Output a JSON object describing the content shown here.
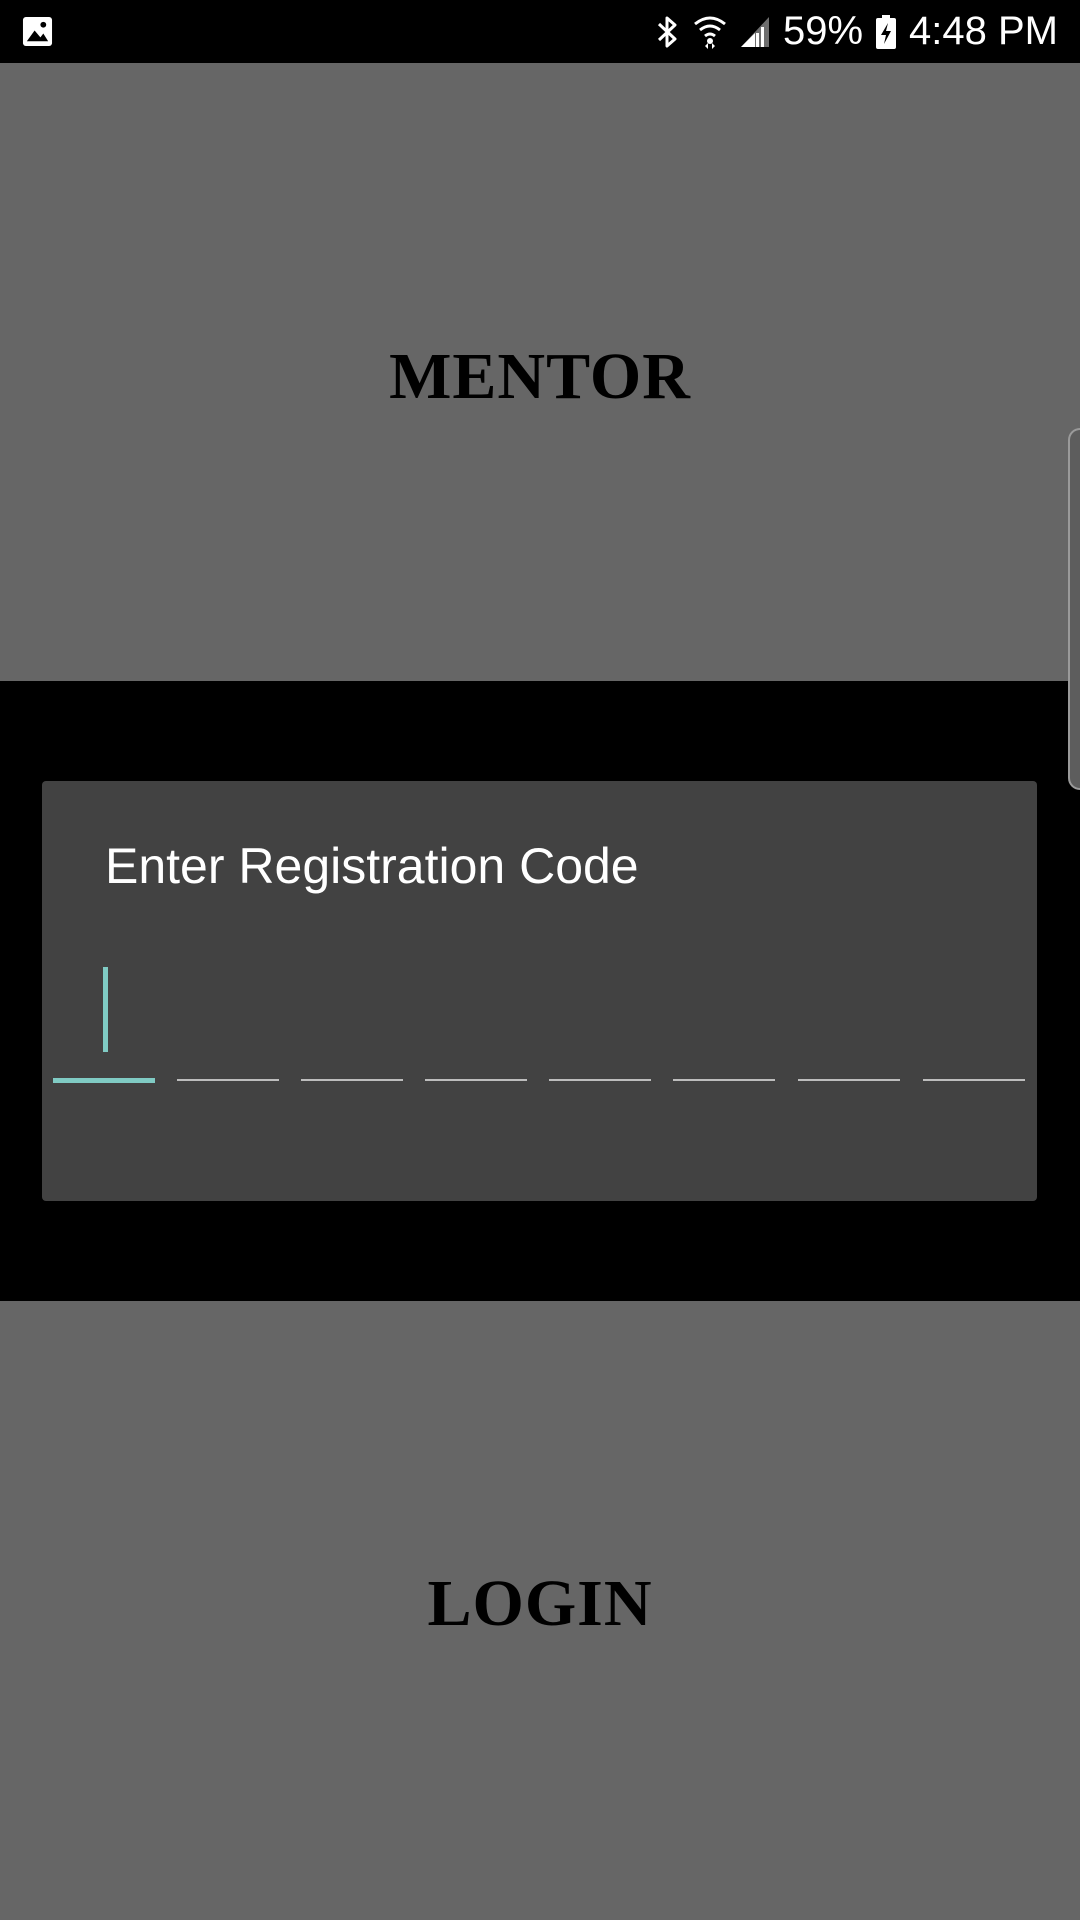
{
  "status_bar": {
    "left_icon": "gallery-image-icon",
    "icons": [
      "bluetooth-icon",
      "wifi-icon",
      "signal-icon"
    ],
    "battery_percent": "59%",
    "battery_icon": "battery-charging-icon",
    "time": "4:48 PM"
  },
  "top_option": {
    "label": "MENTOR"
  },
  "bottom_option": {
    "label": "LOGIN"
  },
  "dialog": {
    "title": "Enter Registration Code",
    "code_length": 8,
    "active_slot": 0,
    "code_value": ""
  },
  "colors": {
    "panel": "#666666",
    "dialog": "#424242",
    "accent": "#80cbc4",
    "slot_line": "#bdbdbd"
  }
}
